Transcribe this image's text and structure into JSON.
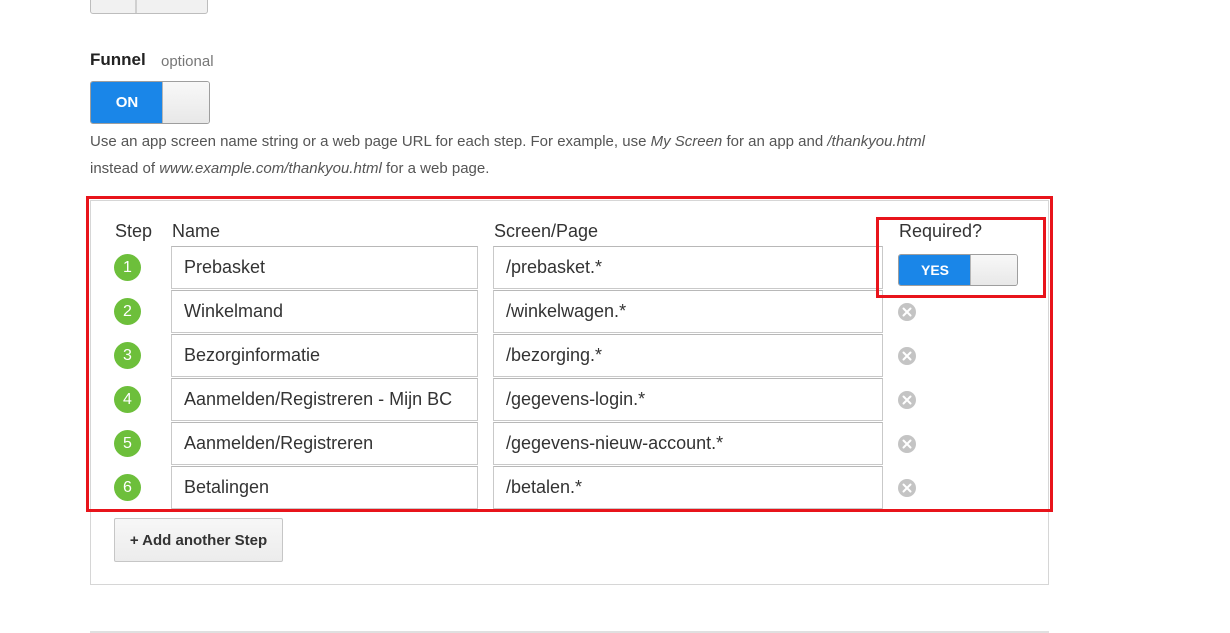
{
  "funnel": {
    "heading": "Funnel",
    "optional_label": "optional",
    "toggle_label": "ON",
    "help_parts": [
      "Use an app screen name string or a web page URL for each step. For example, use ",
      "My Screen",
      " for an app and ",
      "/thankyou.html",
      " instead of ",
      "www.example.com/thankyou.html",
      " for a web page."
    ]
  },
  "table": {
    "headers": {
      "step": "Step",
      "name": "Name",
      "screen": "Screen/Page",
      "required": "Required?"
    },
    "required_toggle_label": "YES",
    "steps": [
      {
        "num": "1",
        "name": "Prebasket",
        "screen": "/prebasket.*"
      },
      {
        "num": "2",
        "name": "Winkelmand",
        "screen": "/winkelwagen.*"
      },
      {
        "num": "3",
        "name": "Bezorginformatie",
        "screen": "/bezorging.*"
      },
      {
        "num": "4",
        "name": "Aanmelden/Registreren - Mijn BC",
        "screen": "/gegevens-login.*"
      },
      {
        "num": "5",
        "name": "Aanmelden/Registreren",
        "screen": "/gegevens-nieuw-account.*"
      },
      {
        "num": "6",
        "name": "Betalingen",
        "screen": "/betalen.*"
      }
    ]
  },
  "add_step_label": "+ Add another Step",
  "colors": {
    "toggle_on": "#1a86e8",
    "step_badge": "#6dbf3b",
    "highlight": "#e8141b"
  },
  "icons": {
    "remove": "close-circle-icon"
  }
}
